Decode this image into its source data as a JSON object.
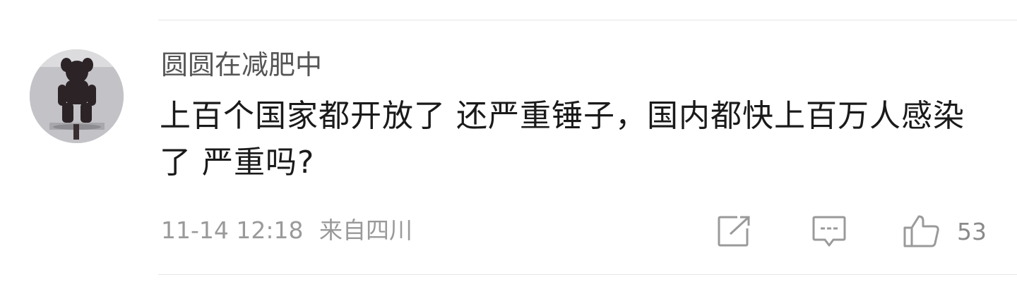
{
  "comment": {
    "username": "圆圆在减肥中",
    "text": "上百个国家都开放了 还严重锤子，国内都快上百万人感染了 严重吗?",
    "date": "11-14 12:18",
    "location": "来自四川",
    "like_count": "53"
  },
  "icons": {
    "share": "share-icon",
    "reply": "reply-icon",
    "like": "thumbs-up-icon"
  },
  "colors": {
    "username": "#555555",
    "text": "#1a1a1a",
    "meta": "#9a9a9a",
    "icon": "#9a9a9a"
  }
}
